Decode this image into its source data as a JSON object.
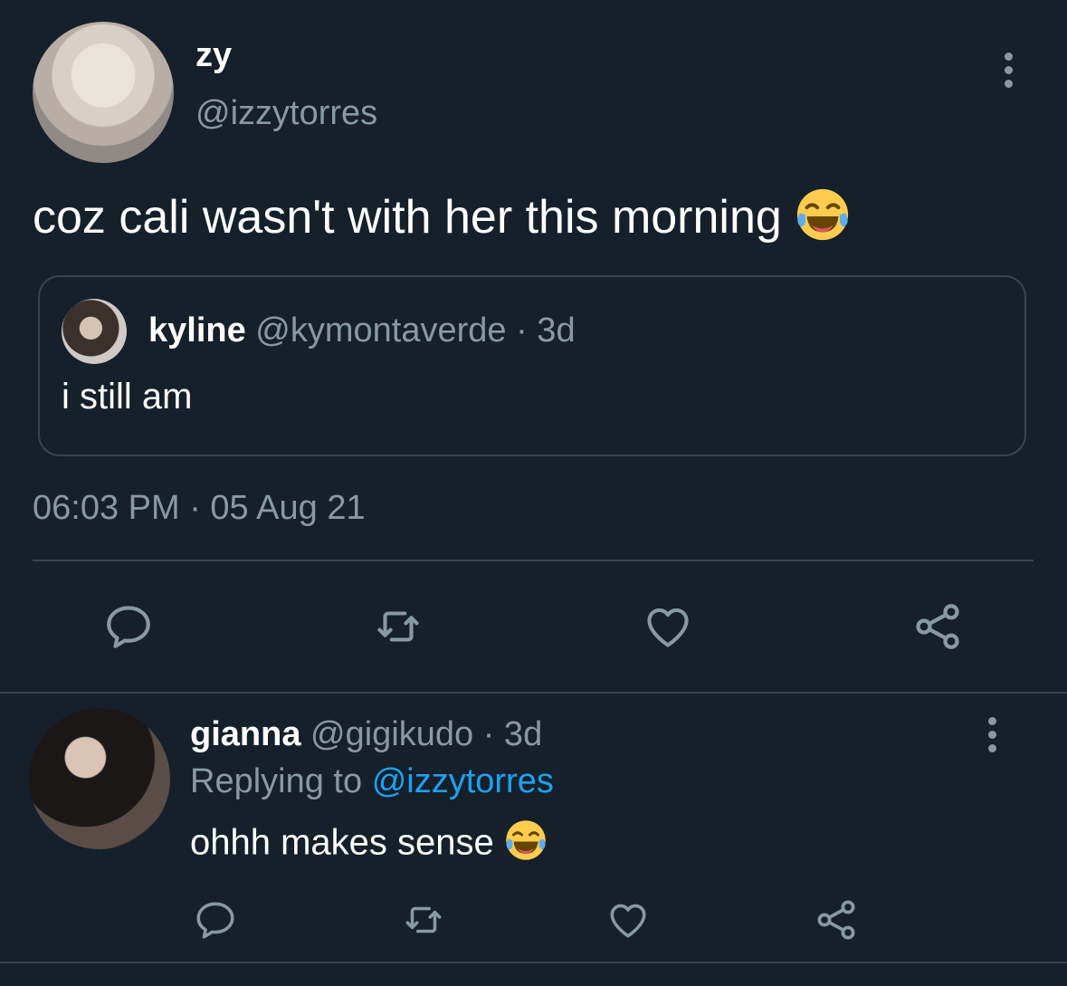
{
  "main_tweet": {
    "display_name": "zy",
    "handle": "@izzytorres",
    "text": "coz cali wasn't with her this morning",
    "emoji": "face-with-tears-of-joy",
    "timestamp": "06:03 PM · 05 Aug 21"
  },
  "quoted_tweet": {
    "display_name": "kyline",
    "handle_and_time": "@kymontaverde · 3d",
    "text": "i still am"
  },
  "reply": {
    "display_name": "gianna",
    "handle_and_time": "@gigikudo · 3d",
    "replying_to_label": "Replying to",
    "replying_to_handle": "@izzytorres",
    "text": "ohhh makes sense",
    "emoji": "face-with-tears-of-joy"
  },
  "colors": {
    "background": "#15202b",
    "muted_text": "#8899a6",
    "link": "#1da1f2",
    "divider": "#38444d"
  },
  "icons": [
    "reply-icon",
    "retweet-icon",
    "like-icon",
    "share-icon",
    "more-options-icon"
  ]
}
